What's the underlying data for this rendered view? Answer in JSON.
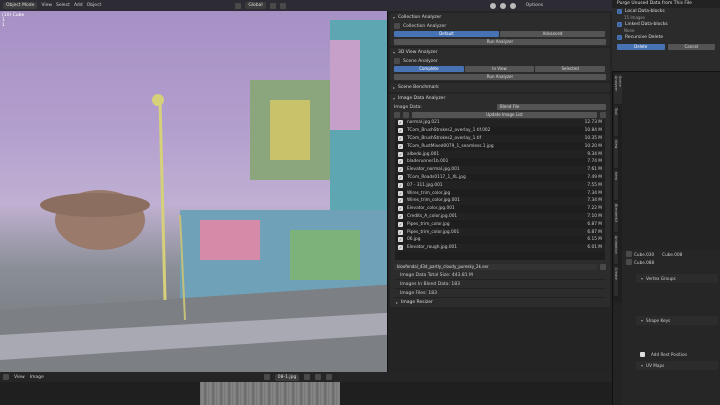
{
  "topbar": {
    "mode": "Object Mode",
    "menus": [
      "View",
      "Select",
      "Add",
      "Object"
    ],
    "orientation": "Global",
    "options": "Options"
  },
  "overlay": {
    "lines": [
      "(10) Cube",
      "1",
      "1"
    ]
  },
  "collection_analyzer": {
    "title": "Collection Analyzer",
    "sub": "Collection Analyzer",
    "tabs": [
      "Default",
      "Advanced"
    ],
    "run": "Run Analyzer"
  },
  "view3d_analyzer": {
    "title": "3D View Analyzer",
    "sub": "Scene Analyzer",
    "tabs": [
      "Complete",
      "In View",
      "Selected"
    ],
    "run": "Run Analyzer"
  },
  "scene_benchmark": {
    "title": "Scene Benchmark"
  },
  "image_analyzer": {
    "title": "Image Data Analyzer",
    "data_label": "Image Data:",
    "data_value": "Blend File",
    "update": "Update Image List",
    "images": [
      {
        "name": "normal.jpg.021",
        "size": "12.73 M"
      },
      {
        "name": "TCom_BrushStrokes2_overlay_1.tif.002",
        "size": "10.84 M"
      },
      {
        "name": "TCom_BrushStrokes2_overlay_1.tif",
        "size": "10.35 M"
      },
      {
        "name": "TCom_RustMixed0079_1_seamless.1.jpg",
        "size": "10.20 M"
      },
      {
        "name": "albedo.jpg.001",
        "size": "9.34 M"
      },
      {
        "name": "bladerunner1b.001",
        "size": "7.74 M"
      },
      {
        "name": "Elevator_normal.jpg.001",
        "size": "7.61 M"
      },
      {
        "name": "TCom_Roads0117_1_XL.jpg",
        "size": "7.49 M"
      },
      {
        "name": "07 - 311.jpg.001",
        "size": "7.55 M"
      },
      {
        "name": "Wires_trim_color.jpg",
        "size": "7.34 M"
      },
      {
        "name": "Wires_trim_color.jpg.001",
        "size": "7.34 M"
      },
      {
        "name": "Elevator_color.jpg.001",
        "size": "7.22 M"
      },
      {
        "name": "Credits_A_color.jpg.001",
        "size": "7.10 M"
      },
      {
        "name": "Pipes_trim_color.jpg",
        "size": "6.87 M"
      },
      {
        "name": "Pipes_trim_color.jpg.001",
        "size": "6.87 M"
      },
      {
        "name": "06.jpg",
        "size": "6.15 M"
      },
      {
        "name": "Elevator_rough.jpg.001",
        "size": "6.01 M"
      }
    ],
    "hdri": "kloofendal_43d_partly_cloudy_puresky_2k.exr",
    "total_size": "Image Data Total Size: 443.81 M",
    "in_blend": "Images In Blend Data: 183",
    "files": "Image Files: 183",
    "resizer": "Image Resizer"
  },
  "purge": {
    "title": "Purge Unused Data from This File",
    "local": "Local Data-blocks",
    "local_count": "15 Images",
    "linked": "Linked Data-blocks",
    "linked_count": "None",
    "recursive": "Recursive Delete",
    "delete": "Delete",
    "cancel": "Cancel"
  },
  "vtabs": [
    "Scene Analyzer",
    "Tool",
    "View",
    "Item",
    "BlenderKit",
    "Animation",
    "Create"
  ],
  "properties": {
    "obj1": "Cube.030",
    "obj2": "Cube.008",
    "mesh": "Cube.088",
    "sections": [
      "Vertex Groups",
      "Shape Keys",
      "Add Rest Position",
      "UV Maps"
    ]
  },
  "bottom": {
    "menus": [
      "View",
      "Image"
    ],
    "image_name": "08-1.jpg"
  }
}
